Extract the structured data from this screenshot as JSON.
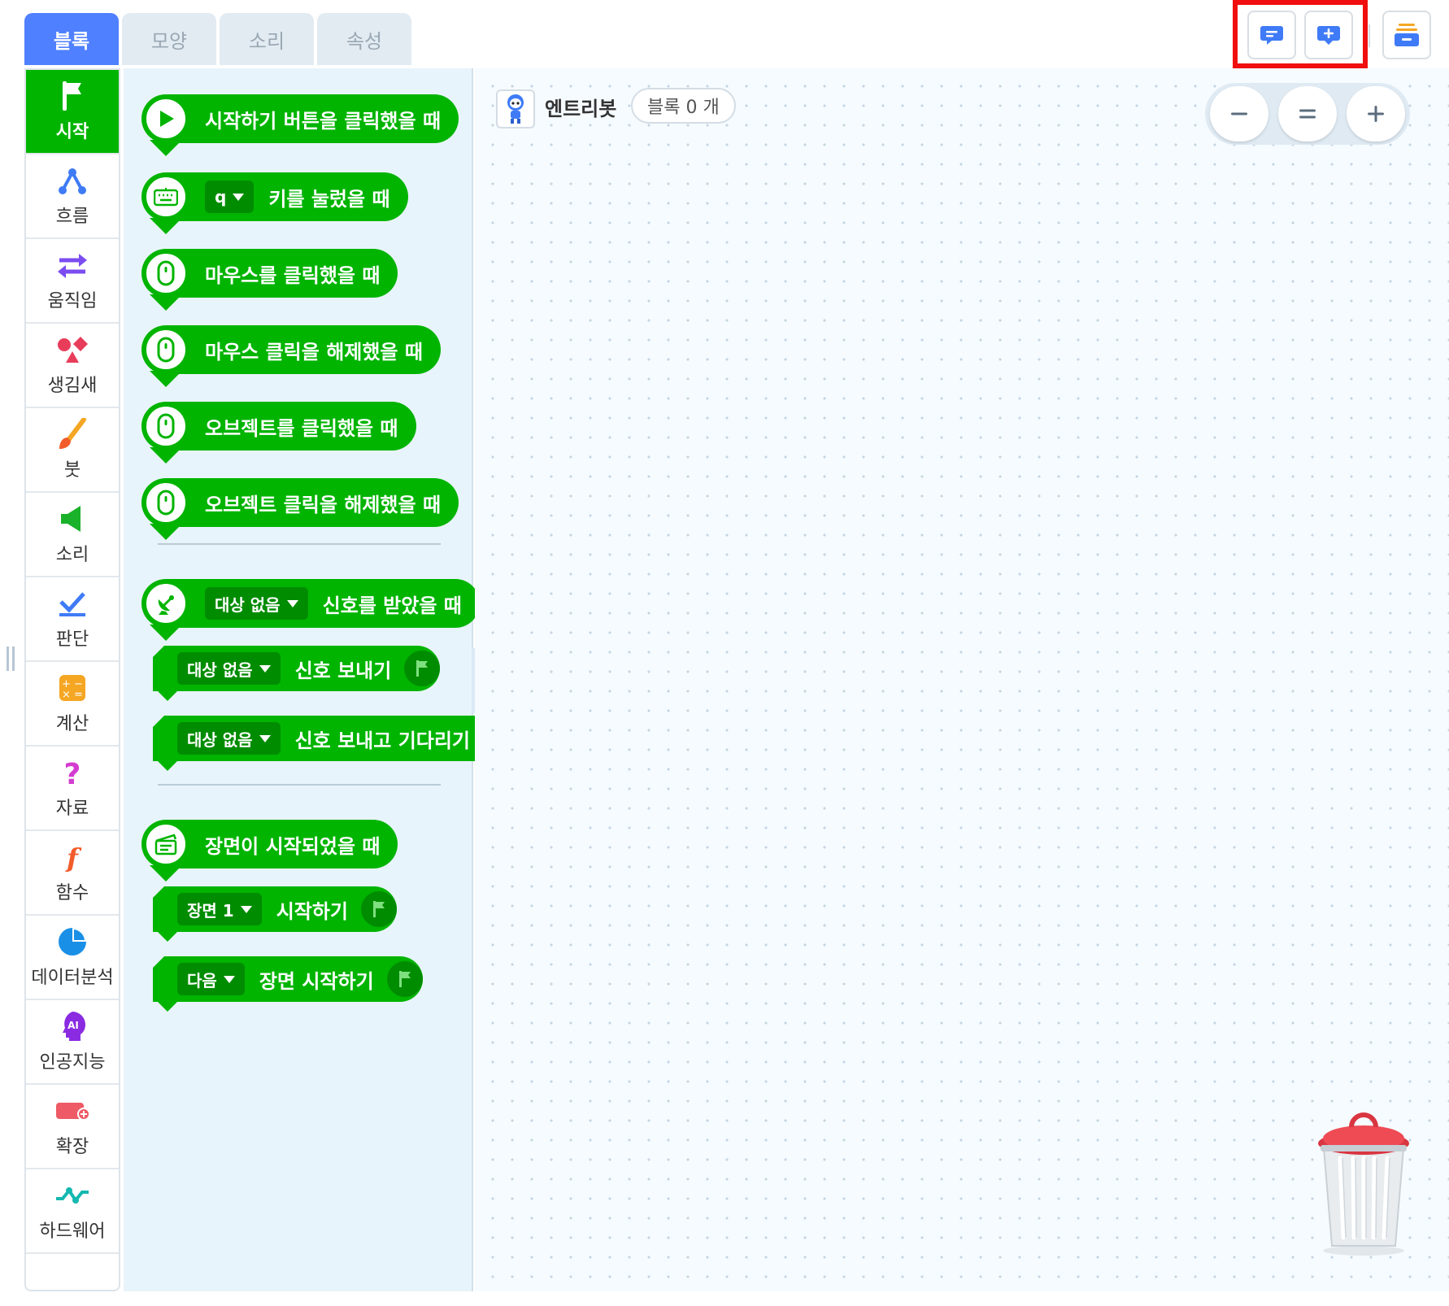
{
  "tabs": [
    "블록",
    "모양",
    "소리",
    "속성"
  ],
  "categories": [
    "시작",
    "흐름",
    "움직임",
    "생김새",
    "붓",
    "소리",
    "판단",
    "계산",
    "자료",
    "함수",
    "데이터분석",
    "인공지능",
    "확장",
    "하드웨어"
  ],
  "palette": {
    "start_button": "시작하기 버튼을 클릭했을 때",
    "key_dropdown": "q",
    "key_pressed": "키를 눌렀을 때",
    "mouse_click": "마우스를 클릭했을 때",
    "mouse_release": "마우스 클릭을 해제했을 때",
    "object_click": "오브젝트를 클릭했을 때",
    "object_release": "오브젝트 클릭을 해제했을 때",
    "signal_dropdown": "대상 없음",
    "signal_received": "신호를 받았을 때",
    "send_signal": "신호 보내기",
    "send_signal_wait": "신호 보내고 기다리기",
    "scene_started": "장면이 시작되었을 때",
    "scene_dropdown": "장면 1",
    "start_scene": "시작하기",
    "next_dropdown": "다음",
    "start_next_scene": "장면 시작하기"
  },
  "workspace": {
    "object_name": "엔트리봇",
    "block_count": "블록 0 개"
  },
  "colors": {
    "accent": "#4f80ff",
    "block_green": "#00b400",
    "dropdown_green": "#008c00",
    "highlight_red": "#f00e0e"
  },
  "icons": [
    "comment-icon",
    "add-comment-icon",
    "block-list-icon",
    "zoom-out-icon",
    "zoom-reset-icon",
    "zoom-in-icon",
    "trash-icon"
  ]
}
